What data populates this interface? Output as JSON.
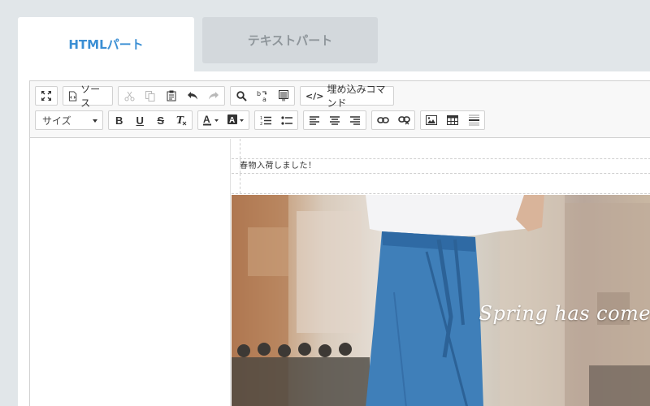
{
  "tabs": [
    {
      "label": "HTMLパート",
      "active": true
    },
    {
      "label": "テキストパート",
      "active": false
    }
  ],
  "toolbar": {
    "maximize_icon": "maximize-icon",
    "source_label": "ソース",
    "embed_label": "埋め込みコマンド",
    "size_label": "サイズ"
  },
  "content": {
    "text_line": "春物入荷しました！",
    "hero_text": "Spring has come"
  },
  "colors": {
    "active_tab_text": "#3b8fd4",
    "inactive_tab_bg": "#d3d8dc",
    "page_bg": "#e1e6e9"
  }
}
